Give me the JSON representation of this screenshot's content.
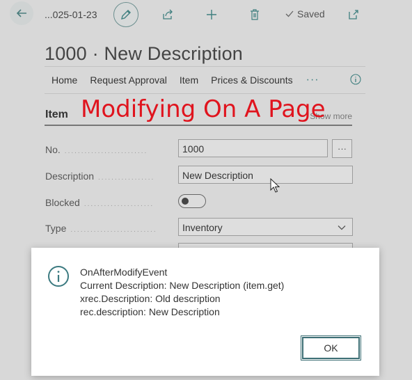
{
  "toolbar": {
    "breadcrumb": "...025-01-23",
    "saved_label": "Saved"
  },
  "page": {
    "title": "1000 · New Description"
  },
  "actions": [
    "Home",
    "Request Approval",
    "Item",
    "Prices & Discounts"
  ],
  "more_actions": "···",
  "section": {
    "title": "Item",
    "show_more": "Show more"
  },
  "overlay_caption": "Modifying On A Page",
  "fields": {
    "no": {
      "label": "No.",
      "value": "1000",
      "assist": "···"
    },
    "description": {
      "label": "Description",
      "value": "New Description"
    },
    "blocked": {
      "label": "Blocked",
      "value": false
    },
    "type": {
      "label": "Type",
      "value": "Inventory"
    }
  },
  "dialog": {
    "lines": [
      "OnAfterModifyEvent",
      "Current Description: New Description (item.get)",
      "xrec.Description: Old description",
      "rec.description: New Description"
    ],
    "ok_label": "OK"
  },
  "colors": {
    "accent": "#3f7f7f",
    "caption": "#e0141e"
  }
}
